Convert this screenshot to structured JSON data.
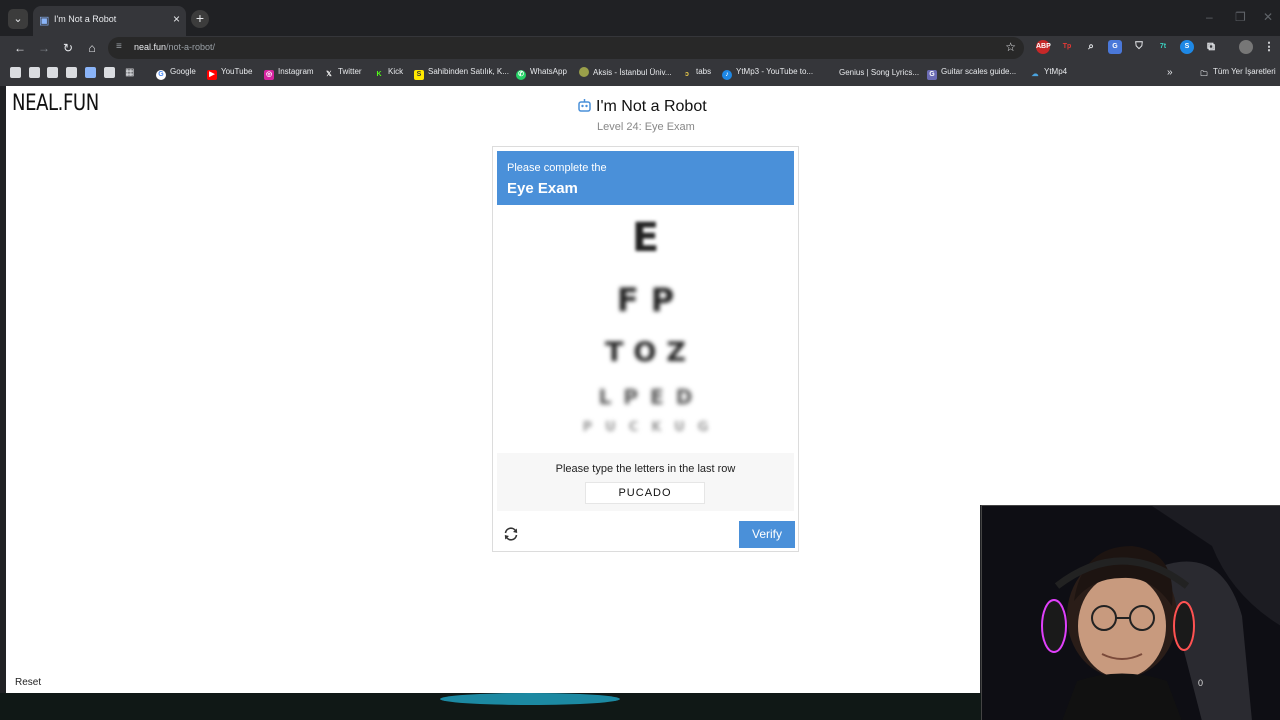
{
  "browser": {
    "tab_title": "I'm Not a Robot",
    "url_host": "neal.fun",
    "url_path": "/not-a-robot/",
    "bookmarks": [
      {
        "label": "Google",
        "color": "#4285f4"
      },
      {
        "label": "YouTube",
        "color": "#ff0000"
      },
      {
        "label": "Instagram",
        "color": "#d6249f"
      },
      {
        "label": "Twitter",
        "color": "#333333"
      },
      {
        "label": "Kick",
        "color": "#53fc18"
      },
      {
        "label": "Sahibinden Satılık, K...",
        "color": "#ffe800"
      },
      {
        "label": "WhatsApp",
        "color": "#25d366"
      },
      {
        "label": "Aksis - İstanbul Üniv...",
        "color": "#9aa04a"
      },
      {
        "label": "tabs",
        "color": "#555555"
      },
      {
        "label": "YtMp3 - YouTube to...",
        "color": "#1e88e5"
      },
      {
        "label": "Genius | Song Lyrics...",
        "color": "#ffff64"
      },
      {
        "label": "Guitar scales guide...",
        "color": "#6b6bb5"
      },
      {
        "label": "YtMp4",
        "color": "#4aa3df"
      }
    ],
    "all_bookmarks_label": "Tüm Yer İşaretleri"
  },
  "site": {
    "logo": "NEAL.FUN",
    "title": "I'm Not a Robot",
    "subtitle": "Level 24: Eye Exam",
    "reset_label": "Reset"
  },
  "captcha": {
    "header_small": "Please complete the",
    "header_big": "Eye Exam",
    "chart_rows": [
      "E",
      "FP",
      "TOZ",
      "LPED",
      "PUCKUG"
    ],
    "prompt": "Please type the letters in the last row",
    "input_value": "PUCADO",
    "verify_label": "Verify",
    "accent_color": "#4a90d9"
  },
  "webcam": {
    "counter": "0"
  }
}
